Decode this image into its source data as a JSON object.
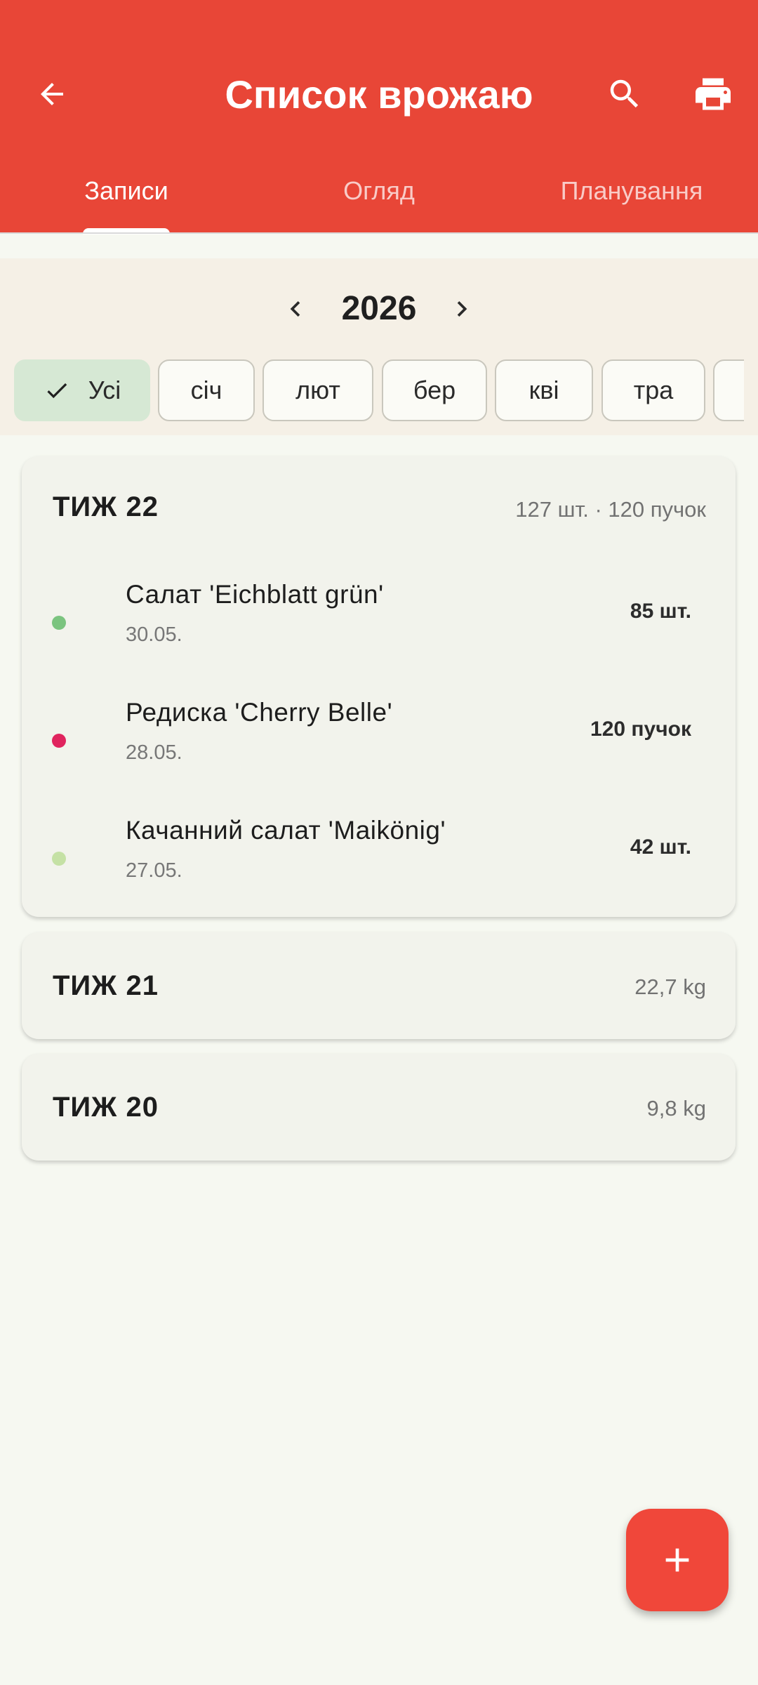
{
  "appbar": {
    "title": "Список врожаю",
    "back_icon": "arrow-left-icon",
    "search_icon": "search-icon",
    "print_icon": "printer-icon",
    "color": "#E84637"
  },
  "tabs": [
    {
      "label": "Записи",
      "active": true
    },
    {
      "label": "Огляд",
      "active": false
    },
    {
      "label": "Планування",
      "active": false
    }
  ],
  "filter": {
    "year": "2026",
    "chips": [
      {
        "label": "Усі",
        "selected": true
      },
      {
        "label": "січ",
        "selected": false
      },
      {
        "label": "лют",
        "selected": false
      },
      {
        "label": "бер",
        "selected": false
      },
      {
        "label": "кві",
        "selected": false
      },
      {
        "label": "тра",
        "selected": false
      }
    ]
  },
  "weeks": [
    {
      "title": "ТИЖ 22",
      "summary": "127 шт. · 120 пучок",
      "expanded": true,
      "entries": [
        {
          "name": "Салат 'Eichblatt grün'",
          "date": "30.05.",
          "qty": "85 шт.",
          "color": "#7BC47F"
        },
        {
          "name": "Редиска 'Cherry Belle'",
          "date": "28.05.",
          "qty": "120 пучок",
          "color": "#E0245E"
        },
        {
          "name": "Качанний салат 'Maikönig'",
          "date": "27.05.",
          "qty": "42 шт.",
          "color": "#C5E1A5"
        }
      ]
    },
    {
      "title": "ТИЖ 21",
      "summary": "22,7 kg",
      "expanded": false
    },
    {
      "title": "ТИЖ 20",
      "summary": "9,8 kg",
      "expanded": false
    }
  ],
  "fab": {
    "icon": "plus-icon",
    "color": "#F0473A"
  }
}
